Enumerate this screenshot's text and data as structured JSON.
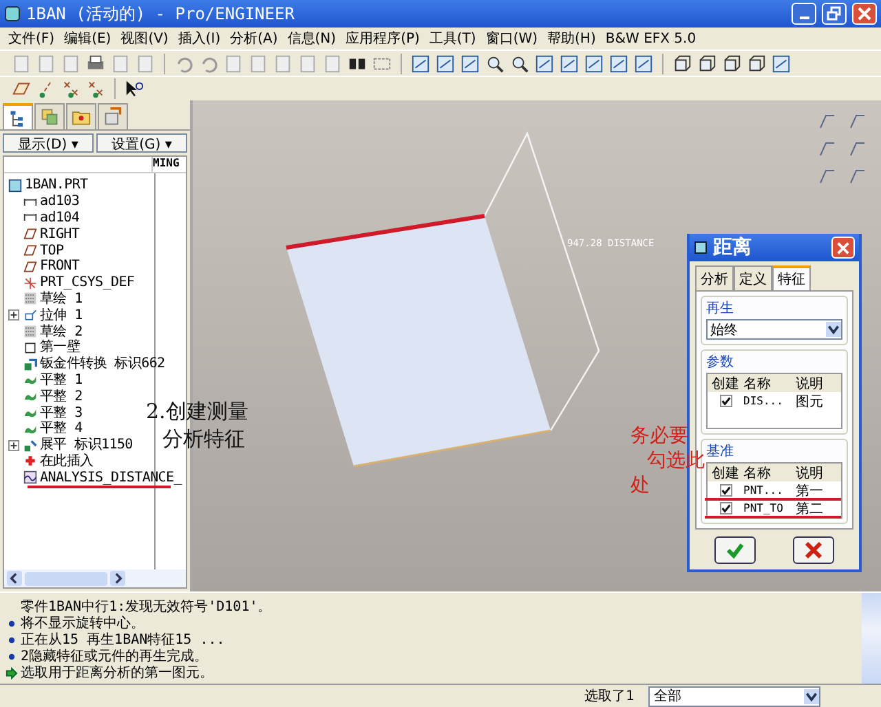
{
  "window": {
    "title": "1BAN (活动的) - Pro/ENGINEER"
  },
  "menu": [
    "文件(F)",
    "编辑(E)",
    "视图(V)",
    "插入(I)",
    "分析(A)",
    "信息(N)",
    "应用程序(P)",
    "工具(T)",
    "窗口(W)",
    "帮助(H)",
    "B&W EFX 5.0"
  ],
  "model_tree": {
    "tabs": [
      {
        "kind": "tree",
        "selected": true
      },
      {
        "kind": "layers",
        "selected": false
      },
      {
        "kind": "folder",
        "selected": false
      },
      {
        "kind": "favorites",
        "selected": false
      }
    ],
    "buttons": [
      "显示(D) ▾",
      "设置(G) ▾"
    ],
    "column_header": "MING",
    "root": {
      "label": "1BAN.PRT",
      "kind": "part"
    },
    "items": [
      {
        "label": "ad103",
        "kind": "dimension"
      },
      {
        "label": "ad104",
        "kind": "dimension"
      },
      {
        "label": "RIGHT",
        "kind": "plane"
      },
      {
        "label": "TOP",
        "kind": "plane"
      },
      {
        "label": "FRONT",
        "kind": "plane"
      },
      {
        "label": "PRT_CSYS_DEF",
        "kind": "csys"
      },
      {
        "label": "草绘 1",
        "kind": "sketch"
      },
      {
        "label": "拉伸 1",
        "kind": "extrude",
        "expanded": false
      },
      {
        "label": "草绘 2",
        "kind": "sketch"
      },
      {
        "label": "第一壁",
        "kind": "wall"
      },
      {
        "label": "钣金件转换 标识662",
        "kind": "sheetmetal"
      },
      {
        "label": "平整 1",
        "kind": "flat"
      },
      {
        "label": "平整 2",
        "kind": "flat"
      },
      {
        "label": "平整 3",
        "kind": "flat"
      },
      {
        "label": "平整 4",
        "kind": "flat"
      },
      {
        "label": "展平 标识1150",
        "kind": "unbend",
        "expanded": false
      },
      {
        "label": "在此插入",
        "kind": "insert"
      },
      {
        "label": "ANALYSIS_DISTANCE_",
        "kind": "analysis",
        "underlined": true
      }
    ]
  },
  "canvas": {
    "dimension_label": "947.28 DISTANCE"
  },
  "annotations": [
    {
      "kind": "black",
      "lines": [
        "2.创建测量",
        "分析特征"
      ]
    },
    {
      "kind": "red",
      "lines": [
        "务必要",
        "勾选此",
        "处"
      ]
    }
  ],
  "dialog": {
    "title": "距离",
    "tabs": [
      {
        "label": "分析",
        "selected": false
      },
      {
        "label": "定义",
        "selected": false
      },
      {
        "label": "特征",
        "selected": true
      }
    ],
    "regen": {
      "legend": "再生",
      "value": "始终"
    },
    "params": {
      "legend": "参数",
      "columns": [
        "创建",
        "名称",
        "说明"
      ],
      "rows": [
        {
          "checked": true,
          "name": "DIS...",
          "desc": "图元"
        }
      ]
    },
    "datums": {
      "legend": "基准",
      "columns": [
        "创建",
        "名称",
        "说明"
      ],
      "rows": [
        {
          "checked": true,
          "name": "PNT...",
          "desc": "第一",
          "underlined": true
        },
        {
          "checked": true,
          "name": "PNT_TO",
          "desc": "第二",
          "underlined": true
        }
      ]
    }
  },
  "messages": [
    {
      "kind": "plain",
      "text": "零件1BAN中行1:发现无效符号'D101'。"
    },
    {
      "kind": "info",
      "text": "将不显示旋转中心。"
    },
    {
      "kind": "info",
      "text": "正在从15 再生1BAN特征15 ..."
    },
    {
      "kind": "info",
      "text": "2隐藏特征或元件的再生完成。"
    },
    {
      "kind": "prompt",
      "text": "选取用于距离分析的第一图元。"
    }
  ],
  "status_bar": {
    "selection": "选取了1",
    "filter": "全部"
  }
}
